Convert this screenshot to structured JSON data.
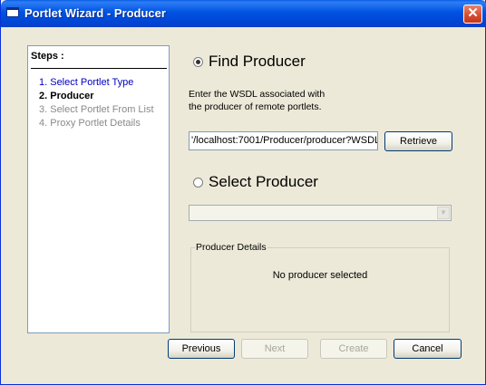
{
  "window": {
    "title": "Portlet Wizard - Producer",
    "close_label": "✕"
  },
  "steps": {
    "heading": "Steps :",
    "items": [
      {
        "label": "1. Select Portlet Type",
        "state": "link"
      },
      {
        "label": "2. Producer",
        "state": "current"
      },
      {
        "label": "3. Select Portlet From List",
        "state": "disabled"
      },
      {
        "label": "4. Proxy Portlet Details",
        "state": "disabled"
      }
    ]
  },
  "find_producer": {
    "label": "Find Producer",
    "selected": true,
    "description_line1": "Enter the WSDL associated with",
    "description_line2": "the producer of remote portlets.",
    "wsdl_value": "'/localhost:7001/Producer/producer?WSDL",
    "retrieve_label": "Retrieve"
  },
  "select_producer": {
    "label": "Select Producer",
    "selected": false,
    "dropdown_value": ""
  },
  "producer_details": {
    "legend": "Producer Details",
    "message": "No producer selected"
  },
  "buttons": {
    "previous": "Previous",
    "next": "Next",
    "create": "Create",
    "cancel": "Cancel"
  },
  "colors": {
    "title_bar": "#0053E1",
    "window_bg": "#ECE9D8",
    "step_link": "#0000C0",
    "step_disabled": "#8A8A8A"
  }
}
